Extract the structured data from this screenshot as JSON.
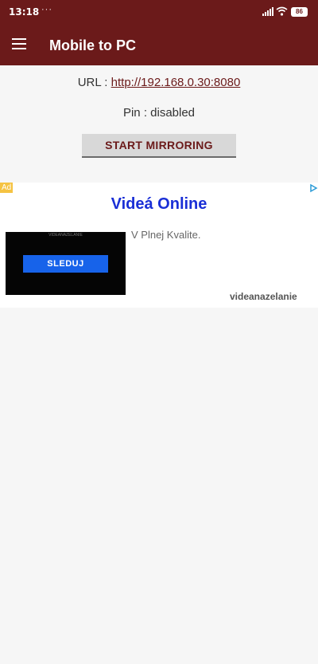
{
  "status_bar": {
    "time": "13:18",
    "dots": "···",
    "battery": "86"
  },
  "app_bar": {
    "title": "Mobile to PC",
    "menu_icon": "hamburger-menu-icon"
  },
  "main": {
    "url_label": "URL :",
    "url_value": "http://192.168.0.30:8080",
    "pin_text": "Pin : disabled",
    "mirror_button_label": "START MIRRORING"
  },
  "ad": {
    "badge": "Ad",
    "title": "Videá Online",
    "image_caption": "VIDEANAZELANIE",
    "cta_label": "SLEDUJ",
    "description": "V Plnej Kvalite.",
    "source": "videanazelanie"
  },
  "colors": {
    "primary": "#6b1a1a",
    "background": "#f6f6f6",
    "ad_title": "#1a2fd6",
    "ad_cta": "#1763ea"
  }
}
